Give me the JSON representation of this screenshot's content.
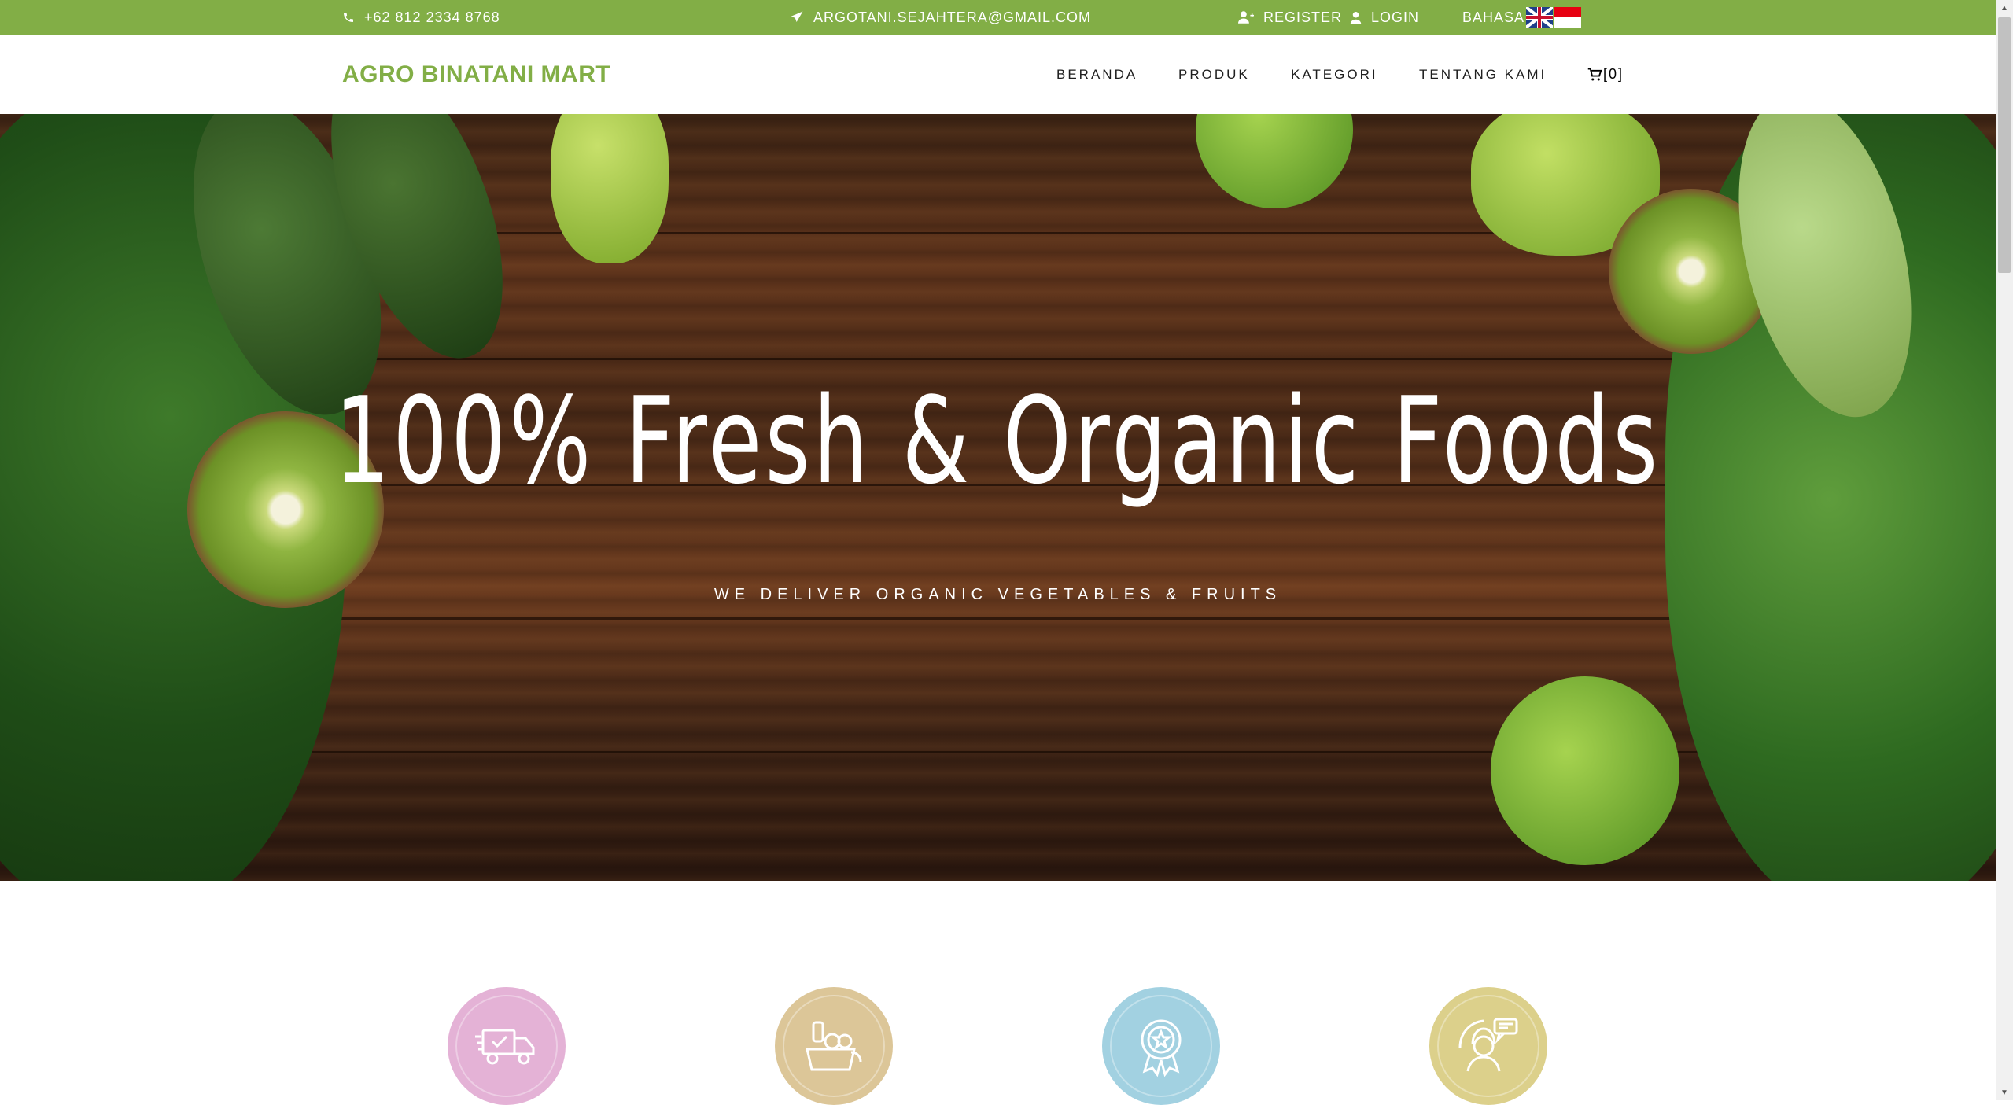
{
  "topbar": {
    "phone": "+62 812 2334 8768",
    "email": "ARGOTANI.SEJAHTERA@GMAIL.COM",
    "register": "REGISTER",
    "login": "LOGIN",
    "language_label": "BAHASA",
    "flags": [
      "english-flag",
      "indonesia-flag"
    ]
  },
  "nav": {
    "brand": "AGRO BINATANI MART",
    "items": [
      "BERANDA",
      "PRODUK",
      "KATEGORI",
      "TENTANG KAMI"
    ],
    "cart_label": "[0]"
  },
  "hero": {
    "title": "100% Fresh & Organic Foods",
    "subtitle": "WE DELIVER ORGANIC VEGETABLES & FRUITS"
  },
  "services": [
    {
      "icon": "delivery-truck-icon",
      "color": "#e4b2d6"
    },
    {
      "icon": "grocery-bag-icon",
      "color": "#dcc698"
    },
    {
      "icon": "quality-badge-icon",
      "color": "#a2d1e1"
    },
    {
      "icon": "customer-support-icon",
      "color": "#dcd08b"
    }
  ],
  "colors": {
    "accent": "#82ae46",
    "text": "#1e1e1e"
  }
}
